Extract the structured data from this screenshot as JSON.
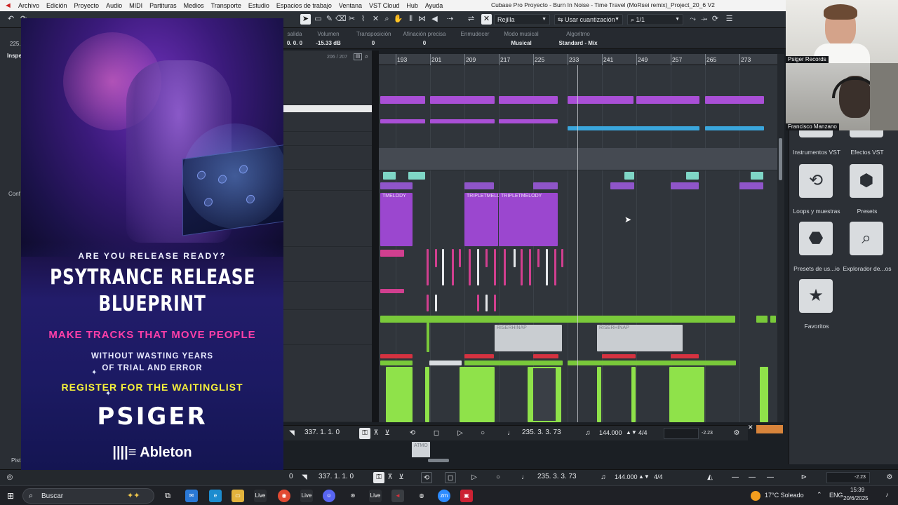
{
  "menu": {
    "items": [
      "Archivo",
      "Edición",
      "Proyecto",
      "Audio",
      "MIDI",
      "Partituras",
      "Medios",
      "Transporte",
      "Estudio",
      "Espacios de trabajo",
      "Ventana",
      "VST Cloud",
      "Hub",
      "Ayuda"
    ],
    "window_title": "Cubase Pro Proyecto - Burn In Noise - Time Travel (MoRsei remix)_Project_20_6 V2"
  },
  "toolbar": {
    "grid_label": "Rejilla",
    "quantize_label": "Usar cuantización",
    "quantize_value": "1/1"
  },
  "infoline": {
    "cols": [
      {
        "h": "salida",
        "v": "0.   0.   0"
      },
      {
        "h": "Volumen",
        "v": "-15.33   dB"
      },
      {
        "h": "Transposición",
        "v": "0"
      },
      {
        "h": "Afinación precisa",
        "v": "0"
      },
      {
        "h": "Enmudecer",
        "v": ""
      },
      {
        "h": "Modo musical",
        "v": "Musical"
      },
      {
        "h": "Algoritmo",
        "v": "Standard - Mix"
      }
    ],
    "left_value": "225."
  },
  "inspector": {
    "label": "Inspe",
    "config_label": "Conf",
    "pist_label": "Pist"
  },
  "tracklist": {
    "count": "206 / 207"
  },
  "ruler": {
    "bars": [
      "193",
      "201",
      "209",
      "217",
      "225",
      "233",
      "241",
      "249",
      "257",
      "265",
      "273"
    ]
  },
  "clips": {
    "melody_a": "TMELODY",
    "melody_b": "TRIPLETMELO",
    "melody_c": "TRIPLETMELODY",
    "riser_a": "RISERHINAP",
    "riser_b": "RISERHINAP",
    "atmo": "ATMO"
  },
  "transport_lower": {
    "position": "337.  1.  1.    0",
    "secondary": "235.  3.  3.  73",
    "tempo": "144.000",
    "signature": "4/4",
    "level": "-2.23"
  },
  "transport_bottom": {
    "zero": "0",
    "position": "337.  1.  1.    0",
    "secondary": "235.  3.  3.  73",
    "tempo": "144.000",
    "signature": "4/4",
    "level": "-2.23"
  },
  "promo": {
    "question": "ARE YOU RELEASE READY?",
    "headline1": "PSYTRANCE RELEASE",
    "headline2": "BLUEPRINT",
    "tagline": "MAKE TRACKS THAT MOVE PEOPLE",
    "sub1": "WITHOUT WASTING YEARS",
    "sub2": "OF TRIAL AND ERROR",
    "cta": "REGISTER FOR THE WAITINGLIST",
    "brand": "PSIGER",
    "partner": "Ableton"
  },
  "rightpanel": {
    "tiles": [
      {
        "label": "Instrumentos VST",
        "icon": "instrument-icon"
      },
      {
        "label": "Efectos VST",
        "icon": "effects-icon"
      },
      {
        "label": "Loops y muestras",
        "icon": "loop-icon"
      },
      {
        "label": "Presets",
        "icon": "presets-icon"
      },
      {
        "label": "Presets de us...io",
        "icon": "user-presets-icon"
      },
      {
        "label": "Explorador de...os",
        "icon": "explorer-icon"
      },
      {
        "label": "Favoritos",
        "icon": "star-icon"
      }
    ]
  },
  "webcams": {
    "top_name": "Psiger Records",
    "bottom_name": "Francisco Manzano"
  },
  "taskbar": {
    "search_placeholder": "Buscar",
    "weather": "17°C  Soleado",
    "lang": "ENG",
    "time": "15:39",
    "date": "20/6/2025",
    "app_labels": {
      "live1": "Live",
      "live2": "Live",
      "live3": "Live",
      "zm": "zm"
    }
  },
  "colors": {
    "purple_clip": "#a94fd6",
    "blue_clip": "#3aa6dc",
    "teal_clip": "#7fd6c6",
    "green_clip": "#8fe24a",
    "red_clip": "#d53240",
    "pink_clip": "#d13f8f"
  }
}
